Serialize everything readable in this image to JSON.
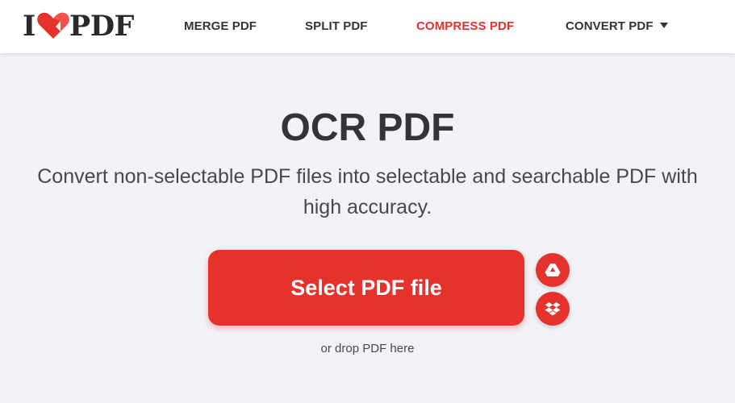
{
  "logo": {
    "text_left": "I",
    "text_right": "PDF"
  },
  "nav": {
    "items": [
      {
        "label": "MERGE PDF"
      },
      {
        "label": "SPLIT PDF"
      },
      {
        "label": "COMPRESS PDF"
      },
      {
        "label": "CONVERT PDF"
      }
    ]
  },
  "main": {
    "title": "OCR PDF",
    "subtitle_line1": "Convert non-selectable PDF files into selectable and searchable PDF with",
    "subtitle_line2": "high accuracy.",
    "select_button_label": "Select PDF file",
    "drop_hint": "or drop PDF here",
    "cloud_buttons": [
      {
        "icon": "google-drive-icon"
      },
      {
        "icon": "dropbox-icon"
      }
    ]
  },
  "colors": {
    "brand_red": "#e5322d",
    "text_dark": "#33333b",
    "background": "#f3f3f7"
  }
}
